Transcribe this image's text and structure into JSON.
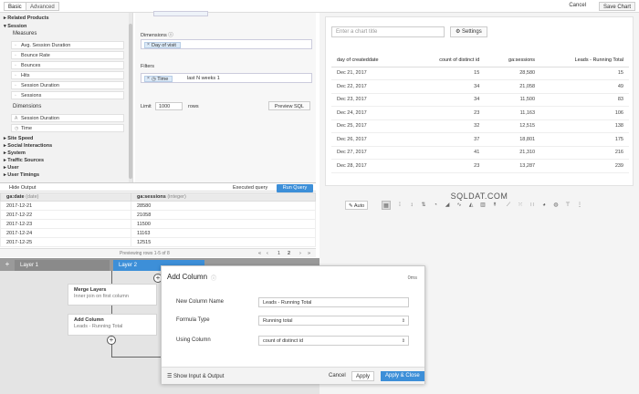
{
  "topbar": {
    "tabs": [
      {
        "label": "Basic"
      },
      {
        "label": "Advanced"
      }
    ],
    "cancel": "Cancel",
    "save_chart": "Save Chart"
  },
  "schema": {
    "related_products": "Related Products",
    "session": "Session",
    "measures_label": "Measures",
    "measures": [
      "Avg. Session Duration",
      "Bounce Rate",
      "Bounces",
      "Hits",
      "Session Duration",
      "Sessions"
    ],
    "dimensions_label": "Dimensions",
    "dimensions": [
      "Session Duration",
      "Time"
    ],
    "groups": [
      "Site Speed",
      "Social Interactions",
      "System",
      "Traffic Sources",
      "User",
      "User Timings"
    ]
  },
  "builder": {
    "dimensions_label": "Dimensions",
    "dimension_pill": "Day of visit",
    "filters_label": "Filters",
    "filter_field": "Time",
    "filter_value": "last N weeks 1",
    "limit_label": "Limit",
    "limit_value": "1000",
    "rows_label": "rows",
    "preview_sql": "Preview SQL"
  },
  "output": {
    "hide": "Hide Output",
    "executed": "Executed query",
    "run": "Run Query",
    "col1": "ga:date",
    "col1_type": "(date)",
    "col2": "ga:sessions",
    "col2_type": "(integer)",
    "rows": [
      [
        "2017-12-21",
        "28580"
      ],
      [
        "2017-12-22",
        "21058"
      ],
      [
        "2017-12-23",
        "11500"
      ],
      [
        "2017-12-24",
        "11163"
      ],
      [
        "2017-12-25",
        "12515"
      ]
    ],
    "pager_text": "Previewing rows 1-5 of 8",
    "pager_pages": [
      "1",
      "2"
    ]
  },
  "layers": {
    "tabs": [
      "Layer 1",
      "Layer 2"
    ],
    "nodes": [
      {
        "title": "Merge Layers",
        "sub": "Inner join on first column"
      },
      {
        "title": "Add Column",
        "sub": "Leads - Running Total"
      }
    ]
  },
  "chart": {
    "title_placeholder": "Enter a chart title",
    "settings": "Settings",
    "columns": [
      "day of createddate",
      "count of distinct id",
      "ga:sessions",
      "Leads - Running Total"
    ],
    "rows": [
      [
        "Dec 21, 2017",
        "15",
        "28,580",
        "15"
      ],
      [
        "Dec 22, 2017",
        "34",
        "21,058",
        "49"
      ],
      [
        "Dec 23, 2017",
        "34",
        "11,500",
        "83"
      ],
      [
        "Dec 24, 2017",
        "23",
        "11,163",
        "106"
      ],
      [
        "Dec 25, 2017",
        "32",
        "12,515",
        "138"
      ],
      [
        "Dec 26, 2017",
        "37",
        "18,801",
        "175"
      ],
      [
        "Dec 27, 2017",
        "41",
        "21,310",
        "216"
      ],
      [
        "Dec 28, 2017",
        "23",
        "13,287",
        "239"
      ]
    ],
    "auto": "Auto"
  },
  "watermark": "SQLDAT.COM",
  "modal": {
    "title": "Add Column",
    "time": "0ms",
    "fields": [
      {
        "label": "New Column Name",
        "value": "Leads - Running Total"
      },
      {
        "label": "Formula Type",
        "value": "Running total"
      },
      {
        "label": "Using Column",
        "value": "count of distinct id"
      }
    ],
    "show_io": "Show Input & Output",
    "cancel": "Cancel",
    "apply": "Apply",
    "apply_close": "Apply & Close"
  }
}
